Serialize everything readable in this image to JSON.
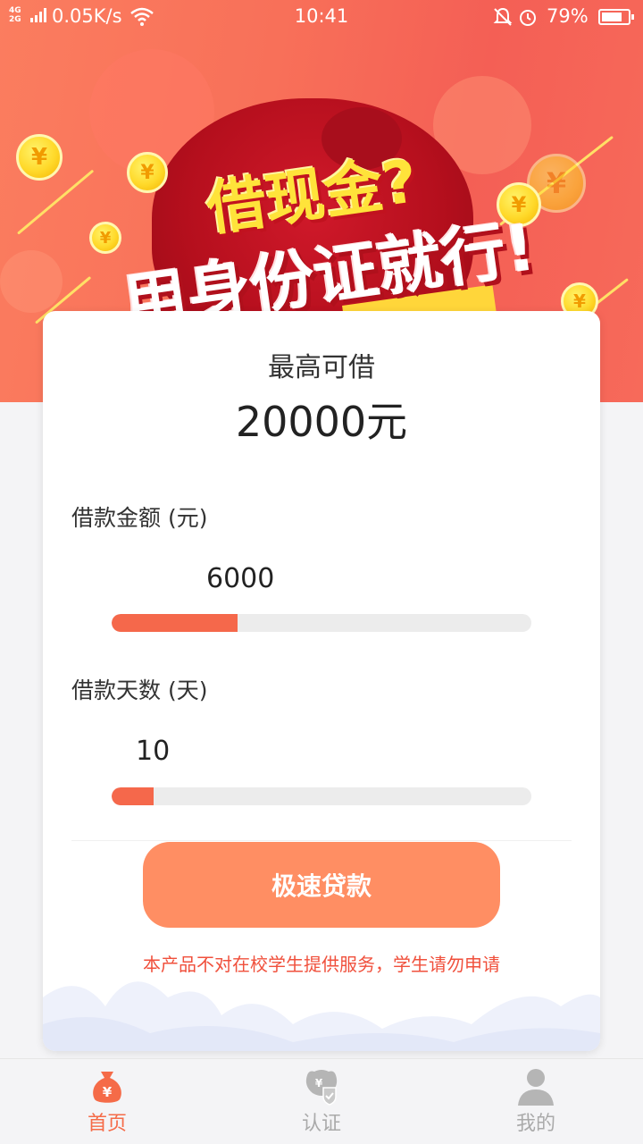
{
  "status_bar": {
    "network_top": "4G",
    "network_bottom": "2G",
    "speed": "0.05K/s",
    "time": "10:41",
    "battery": "79%",
    "battery_level": 0.79,
    "icons": [
      "signal-icon",
      "wifi-icon",
      "mute-icon",
      "alarm-icon",
      "battery-icon"
    ]
  },
  "banner": {
    "line1": "借现金?",
    "line2": "用身份证就行!",
    "coin_symbol": "¥",
    "colors": {
      "background": "#f87059",
      "bag": "#c0141f",
      "coin": "#ffd92a",
      "line1": "#ffe33a"
    }
  },
  "loan_card": {
    "max_label": "最高可借",
    "max_amount": "20000元",
    "amount_label": "借款金额 (元)",
    "amount_value": "6000",
    "amount_fraction": 0.3,
    "days_label": "借款天数 (天)",
    "days_value": "10",
    "days_fraction": 0.1,
    "button_label": "极速贷款",
    "disclaimer": "本产品不对在校学生提供服务，学生请勿申请",
    "colors": {
      "slider_fill": "#f5684b",
      "slider_track": "#ececec",
      "button": "#ff8e63",
      "disclaimer": "#f0503c"
    }
  },
  "tabs": [
    {
      "label": "首页",
      "icon": "money-bag-icon",
      "active": true
    },
    {
      "label": "认证",
      "icon": "verify-shield-icon",
      "active": false
    },
    {
      "label": "我的",
      "icon": "user-profile-icon",
      "active": false
    }
  ],
  "accent_color": "#f56b48"
}
